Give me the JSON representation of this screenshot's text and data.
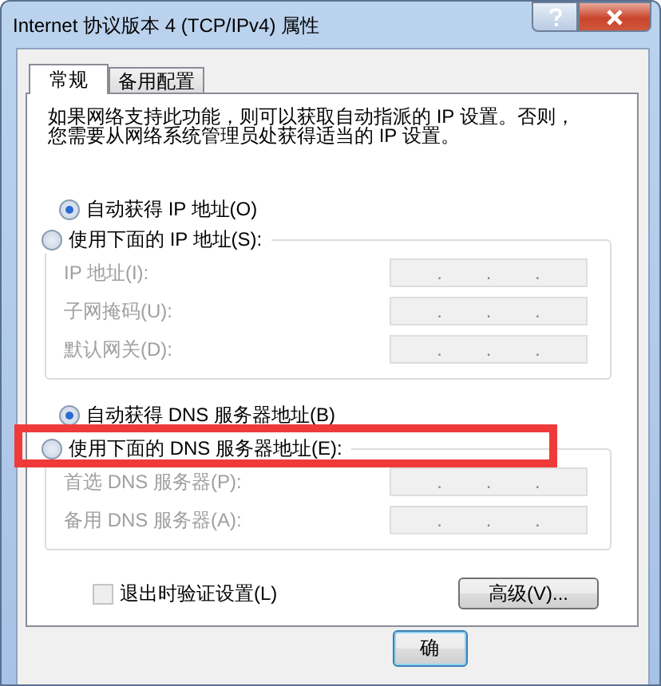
{
  "window": {
    "title": "Internet 协议版本 4 (TCP/IPv4) 属性"
  },
  "tabs": [
    {
      "label": "常规",
      "selected": true
    },
    {
      "label": "备用配置",
      "selected": false
    }
  ],
  "description_lines": [
    "如果网络支持此功能，则可以获取自动指派的 IP 设置。否则，",
    "您需要从网络系统管理员处获得适当的 IP 设置。"
  ],
  "ip_section": {
    "auto_option": {
      "label": "自动获得 IP 地址(O)",
      "selected": true,
      "highlighted": false
    },
    "manual_option": {
      "label": "使用下面的 IP 地址(S):",
      "selected": false,
      "highlighted": false
    },
    "fields": [
      {
        "label": "IP 地址(I):",
        "value": ". . .",
        "disabled": true
      },
      {
        "label": "子网掩码(U):",
        "value": ". . .",
        "disabled": true
      },
      {
        "label": "默认网关(D):",
        "value": ". . .",
        "disabled": true
      }
    ]
  },
  "dns_section": {
    "auto_option": {
      "label": "自动获得 DNS 服务器地址(B)",
      "selected": true,
      "highlighted": false
    },
    "manual_option": {
      "label": "使用下面的 DNS 服务器地址(E):",
      "selected": false,
      "highlighted": true
    },
    "fields": [
      {
        "label": "首选 DNS 服务器(P):",
        "value": ". . .",
        "disabled": true
      },
      {
        "label": "备用 DNS 服务器(A):",
        "value": ". . .",
        "disabled": true
      }
    ]
  },
  "validate_checkbox": {
    "label": "退出时验证设置(L)",
    "checked": false,
    "disabled": true
  },
  "advanced_button": {
    "label": "高级(V)..."
  },
  "dialog_buttons": [
    {
      "label": "确"
    }
  ]
}
